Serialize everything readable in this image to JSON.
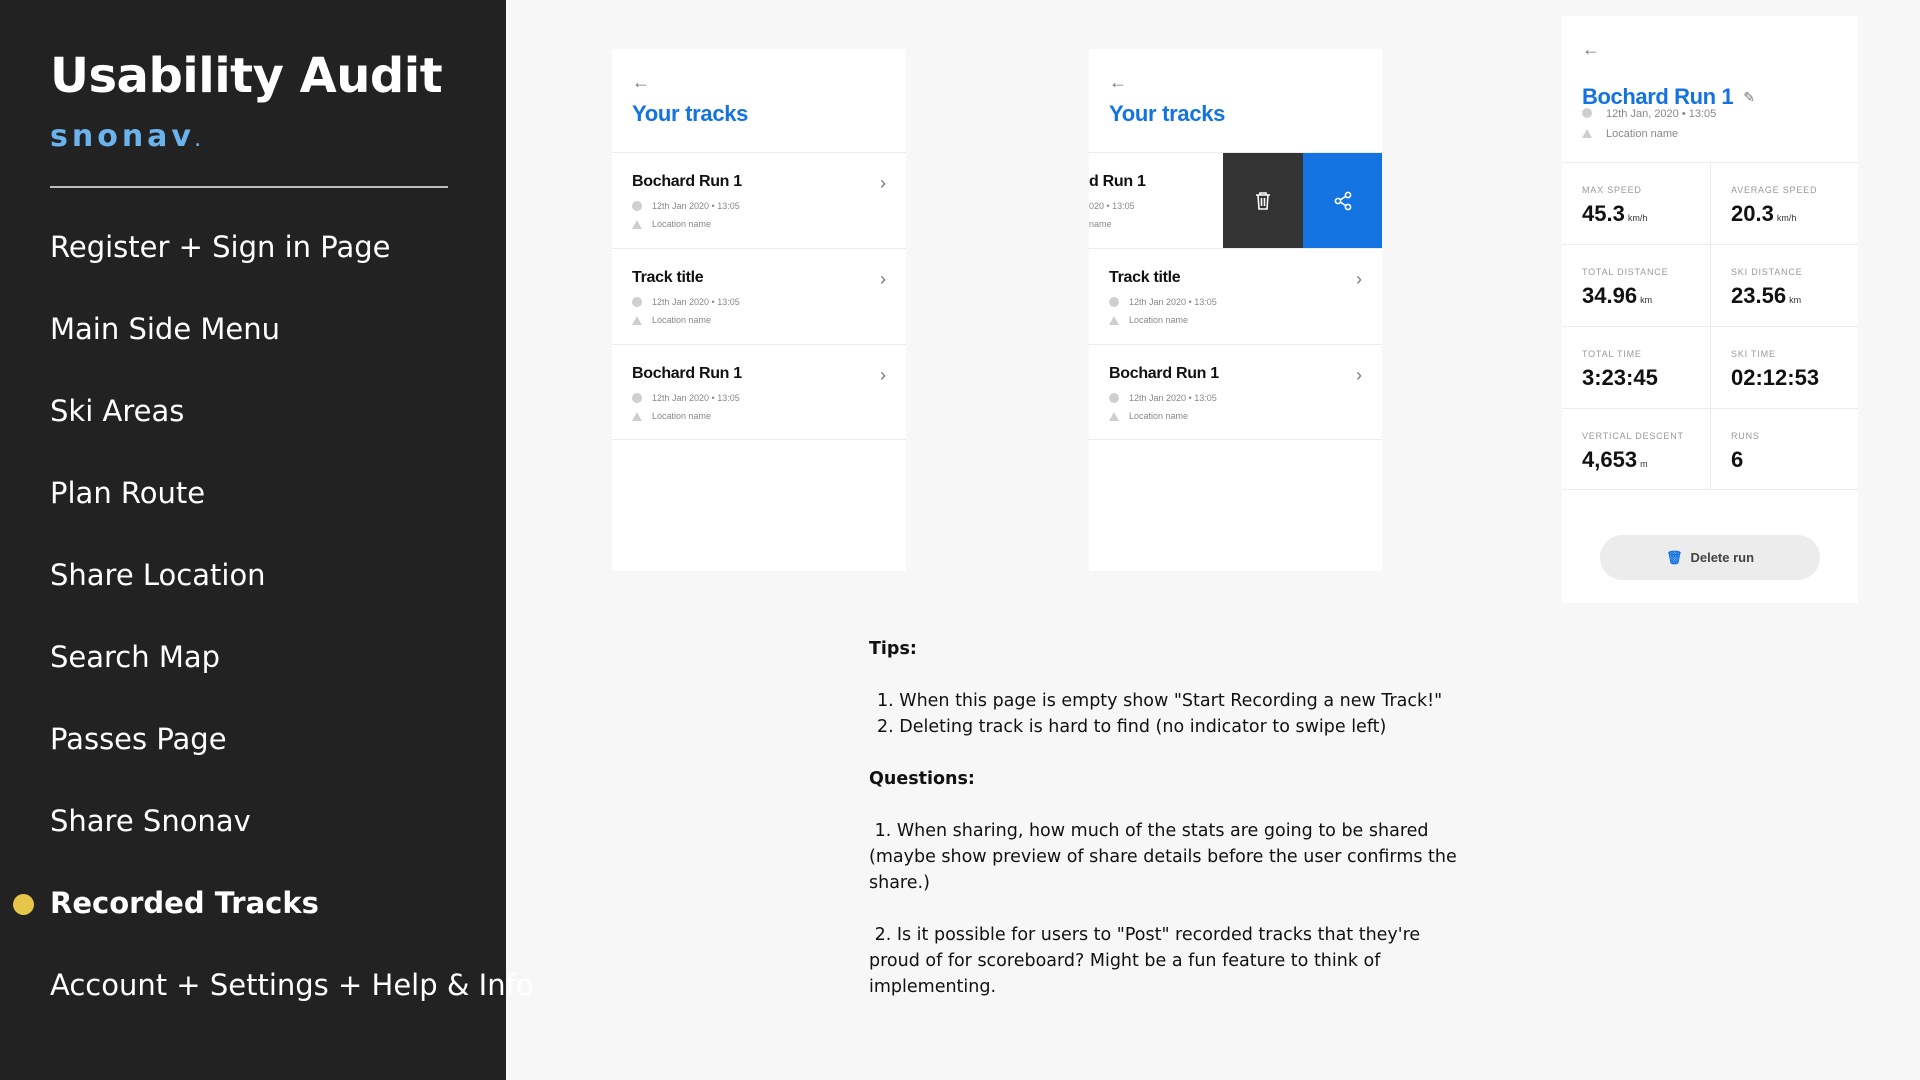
{
  "sidebar": {
    "title": "Usability Audit",
    "logo": "snonav",
    "logo_suffix": ".",
    "items": [
      {
        "label": "Register + Sign in Page"
      },
      {
        "label": "Main Side Menu"
      },
      {
        "label": "Ski Areas"
      },
      {
        "label": "Plan Route"
      },
      {
        "label": "Share Location"
      },
      {
        "label": "Search Map"
      },
      {
        "label": "Passes Page"
      },
      {
        "label": "Share Snonav"
      },
      {
        "label": "Recorded Tracks",
        "active": true
      },
      {
        "label": "Account + Settings + Help & Info"
      }
    ],
    "active_dot_color": "#e6c64a"
  },
  "colors": {
    "sidebar_bg": "#222222",
    "accent_blue": "#1373e0",
    "swipe_delete_bg": "#333333"
  },
  "screen1": {
    "back_icon": "arrow-left-icon",
    "title": "Your tracks",
    "tracks": [
      {
        "title": "Bochard Run 1",
        "datetime": "12th Jan 2020 • 13:05",
        "location": "Location name"
      },
      {
        "title": "Track title",
        "datetime": "12th Jan 2020 • 13:05",
        "location": "Location name"
      },
      {
        "title": "Bochard Run 1",
        "datetime": "12th Jan 2020 • 13:05",
        "location": "Location name"
      }
    ]
  },
  "screen2": {
    "back_icon": "arrow-left-icon",
    "title": "Your tracks",
    "swiped_track": {
      "title": "d Run 1",
      "datetime": "020 • 13:05",
      "location": "name"
    },
    "swipe_actions": [
      "trash-icon",
      "share-icon"
    ],
    "tracks": [
      {
        "title": "Track title",
        "datetime": "12th Jan 2020 • 13:05",
        "location": "Location name"
      },
      {
        "title": "Bochard Run 1",
        "datetime": "12th Jan 2020 • 13:05",
        "location": "Location name"
      }
    ]
  },
  "screen3": {
    "back_icon": "arrow-left-icon",
    "title": "Bochard Run 1",
    "edit_icon": "edit-icon",
    "datetime": "12th Jan, 2020 • 13:05",
    "location": "Location name",
    "stats": [
      {
        "label": "MAX SPEED",
        "value": "45.3",
        "unit": "km/h"
      },
      {
        "label": "AVERAGE SPEED",
        "value": "20.3",
        "unit": "km/h"
      },
      {
        "label": "TOTAL DISTANCE",
        "value": "34.96",
        "unit": "km"
      },
      {
        "label": "SKI DISTANCE",
        "value": "23.56",
        "unit": "km"
      },
      {
        "label": "TOTAL TIME",
        "value": "3:23:45",
        "unit": ""
      },
      {
        "label": "SKI TIME",
        "value": "02:12:53",
        "unit": ""
      },
      {
        "label": "VERTICAL DESCENT",
        "value": "4,653",
        "unit": "m"
      },
      {
        "label": "RUNS",
        "value": "6",
        "unit": ""
      }
    ],
    "delete_label": "Delete run"
  },
  "notes": {
    "tips_heading": "Tips:",
    "tips": [
      "1. When this page is empty show \"Start Recording a new Track!\"",
      "2. Deleting track is hard to find (no indicator to swipe left)"
    ],
    "questions_heading": "Questions:",
    "questions": [
      " 1. When sharing, how much of the stats are going to be shared (maybe show preview of share details before the user confirms the share.)",
      " 2. Is it possible for users to \"Post\" recorded tracks that they're proud of for scoreboard? Might be a fun feature to think of implementing."
    ]
  }
}
